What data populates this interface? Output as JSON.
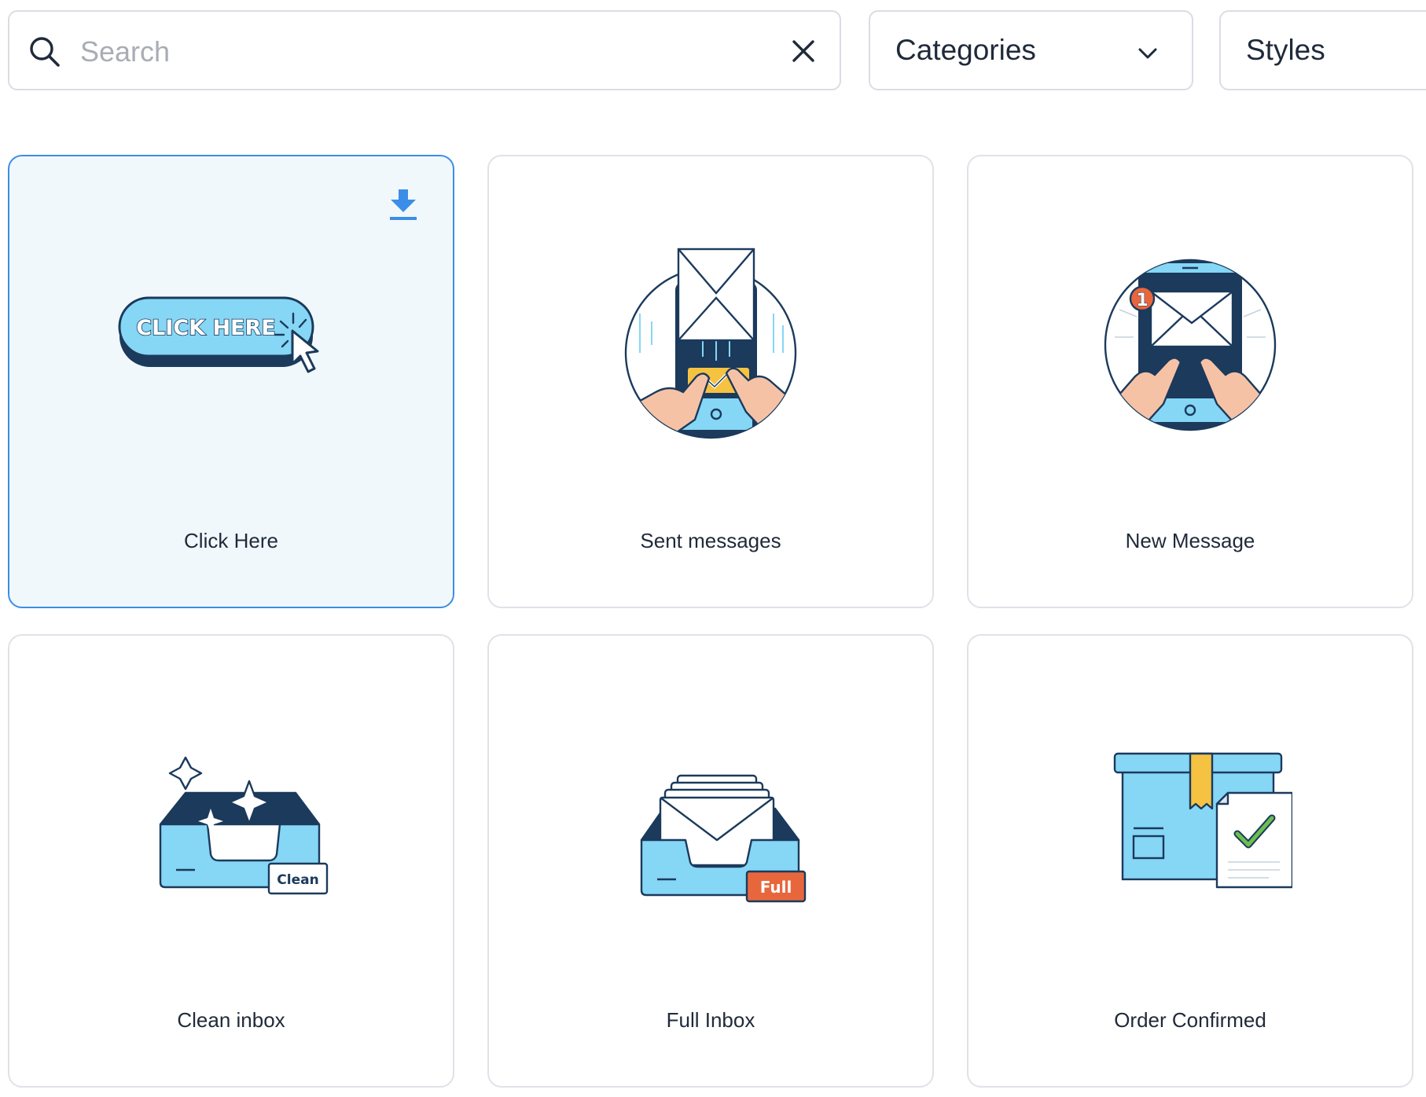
{
  "search": {
    "placeholder": "Search",
    "value": ""
  },
  "filters": {
    "categories_label": "Categories",
    "styles_label": "Styles"
  },
  "colors": {
    "accent": "#3b8ee8",
    "selected_bg": "#f1f8fc",
    "navy": "#1b3a5c",
    "light_blue": "#86d6f5",
    "yellow": "#f5c242",
    "orange": "#e8663c",
    "skin": "#f6c2a6",
    "green": "#6bbf4e"
  },
  "cards": [
    {
      "label": "Click Here",
      "button_text": "CLICK HERE",
      "selected": true,
      "icon": "download-icon"
    },
    {
      "label": "Sent messages"
    },
    {
      "label": "New Message",
      "badge": "1"
    },
    {
      "label": "Clean inbox",
      "tag": "Clean"
    },
    {
      "label": "Full Inbox",
      "tag": "Full"
    },
    {
      "label": "Order Confirmed"
    }
  ]
}
